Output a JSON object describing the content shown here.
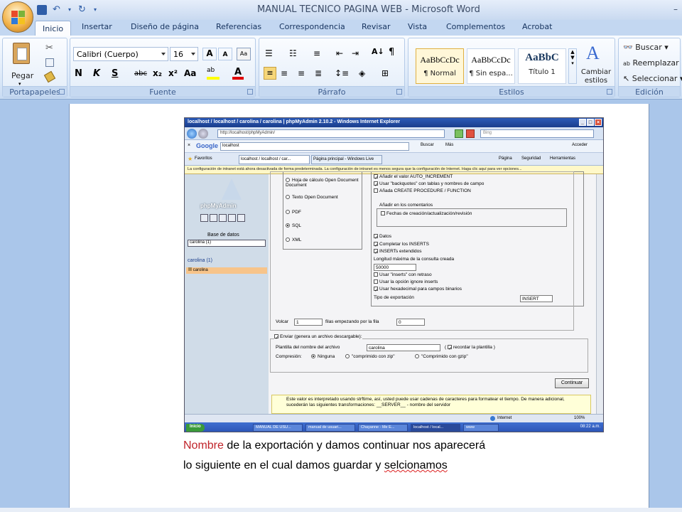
{
  "window": {
    "title": "MANUAL TECNICO PAGINA WEB - Microsoft Word"
  },
  "ribbon_tabs": [
    "Inicio",
    "Insertar",
    "Diseño de página",
    "Referencias",
    "Correspondencia",
    "Revisar",
    "Vista",
    "Complementos",
    "Acrobat"
  ],
  "ribbon": {
    "clipboard": {
      "label": "Portapapeles",
      "paste": "Pegar"
    },
    "font": {
      "label": "Fuente",
      "font_name": "Calibri (Cuerpo)",
      "font_size": "16"
    },
    "paragraph": {
      "label": "Párrafo"
    },
    "styles": {
      "label": "Estilos",
      "items": [
        {
          "sample": "AaBbCcDc",
          "name": "¶ Normal"
        },
        {
          "sample": "AaBbCcDc",
          "name": "¶ Sin espa..."
        },
        {
          "sample": "AaBbC",
          "name": "Título 1"
        }
      ],
      "change_styles": "Cambiar estilos"
    },
    "editing": {
      "label": "Edición",
      "find": "Buscar",
      "replace": "Reemplazar",
      "select": "Seleccionar"
    }
  },
  "embedded": {
    "ie_title": "localhost / localhost / carolina / carolina | phpMyAdmin 2.10.2 - Windows Internet Explorer",
    "url": "http://localhost/phpMyAdmin/",
    "search_placeholder": "Bing",
    "google_query": "localhost",
    "google_buttons": {
      "search": "Buscar",
      "more": "Más",
      "signin": "Acceder"
    },
    "favorites": "Favoritos",
    "tabs": [
      "localhost / localhost / car...",
      "Página principal - Windows Live"
    ],
    "tools": [
      "Página",
      "Seguridad",
      "Herramientas"
    ],
    "infobar": "La configuración de intranet está ahora desactivada de forma predeterminada. La configuración de intranet es menos segura que la configuración de Internet. Haga clic aquí para ver opciones...",
    "pma": {
      "logo": "phpMyAdmin",
      "db_label": "Base de datos",
      "db_select": "carolina (1)",
      "db_heading": "carolina (1)",
      "table": "carolina",
      "formats": [
        {
          "label": "Hoja de cálculo Open Document",
          "checked": false
        },
        {
          "label": "Texto Open Document",
          "checked": false
        },
        {
          "label": "PDF",
          "checked": false
        },
        {
          "label": "SQL",
          "checked": true
        },
        {
          "label": "XML",
          "checked": false
        }
      ],
      "structure_options": [
        {
          "label": "Añadir el valor AUTO_INCREMENT",
          "checked": true
        },
        {
          "label": "Usar \"backquotes\" con tablas y nombres de campo",
          "checked": true
        },
        {
          "label": "Añada CREATE PROCEDURE / FUNCTION",
          "checked": false
        }
      ],
      "comments_legend": "Añadir en los comentarios",
      "comments_option": "Fechas de creación/actualización/revisión",
      "data_legend": "Datos",
      "data_options": [
        {
          "label": "Completar los INSERTS",
          "checked": true
        },
        {
          "label": "INSERTs extendidos",
          "checked": true
        }
      ],
      "max_query_label": "Longitud máxima de la consulta creada",
      "max_query_value": "50000",
      "data_options2": [
        {
          "label": "Usar \"inserts\" con retraso",
          "checked": false
        },
        {
          "label": "Usar la opción ignore inserts",
          "checked": false
        },
        {
          "label": "Usar hexadecimal para campos binarios",
          "checked": true
        }
      ],
      "export_type_label": "Tipo de exportación",
      "export_type_value": "INSERT",
      "dump_prefix": "Volcar",
      "dump_rows": "1",
      "dump_mid": "filas empezando por la fila",
      "dump_start": "0",
      "send_label": "Enviar (genera un archivo descargable):",
      "template_label": "Plantilla del nombre del archivo",
      "template_value": "carolina",
      "remember_label": "recordar la plantilla",
      "compression_label": "Compresión:",
      "compression_options": [
        {
          "label": "Ninguna",
          "checked": true
        },
        {
          "label": "\"comprimido con zip\"",
          "checked": false
        },
        {
          "label": "\"Comprimido con gzip\"",
          "checked": false
        }
      ],
      "continue_button": "Continuar",
      "notice": "Este valor es interpretado usando strftime, así, usted puede usar cadenas de caracteres para formatear el tiempo. De manera adicional, sucederán las siguientes transformaciones: __SERVER__ - nombre del servidor"
    },
    "status_zone": "Internet",
    "status_zoom": "100%",
    "taskbar": {
      "start": "Inicio",
      "items": [
        "MANUAL DE USU...",
        "manual de usuari...",
        "Chayanne - Me E...",
        "localhost / local...",
        "www"
      ],
      "clock": "08:22 a.m."
    }
  },
  "document": {
    "line1_red": "Nombre",
    "line1_rest": " de la exportación y damos continuar  nos aparecerá",
    "line2_main": "lo siguiente  en el cual damos guardar y ",
    "line2_misspelled": "selcionamos"
  },
  "colors": {
    "accent": "#c0242a",
    "ribbon_blue": "#c3d7f1",
    "ie_title": "#1a3d8c"
  }
}
